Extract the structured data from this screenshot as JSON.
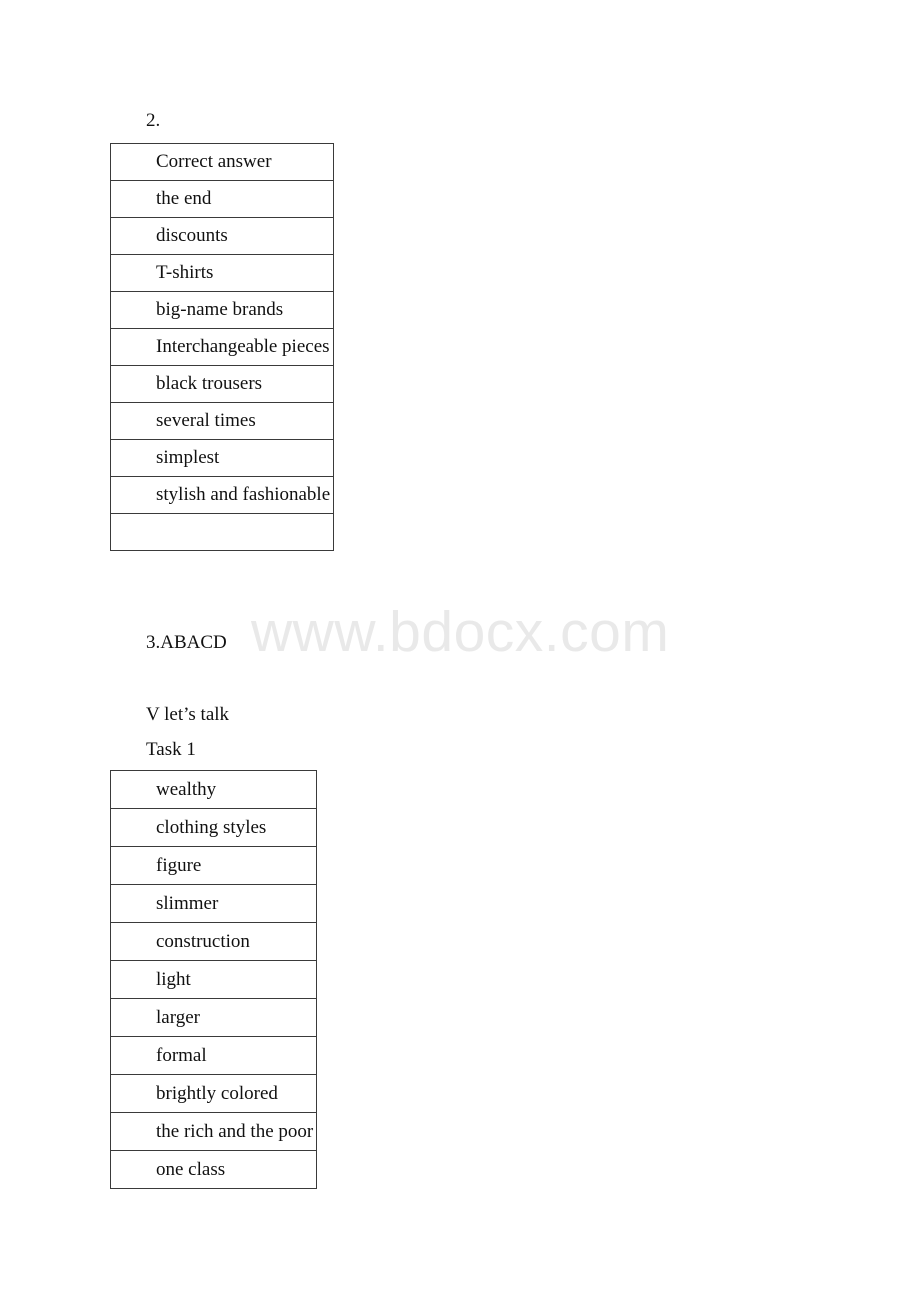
{
  "page": {
    "watermark_text": "www.bdocx.com",
    "watermark_color": "#e9e9e9",
    "background_color": "#ffffff",
    "text_color": "#111111",
    "table_border_color": "#3a3a3a"
  },
  "sections": {
    "item_2_label": "2.",
    "item_3_answers": "3.ABACD",
    "section_heading": "V let’s talk",
    "task_label": "Task 1"
  },
  "table_answers": {
    "header": "Correct answer",
    "rows": [
      "the end",
      "discounts",
      "T-shirts",
      "big-name brands",
      "Interchangeable pieces",
      "black trousers",
      "several times",
      "simplest",
      "stylish and fashionable",
      ""
    ]
  },
  "table_task1": {
    "rows": [
      "wealthy",
      "clothing styles",
      "figure",
      "slimmer",
      "construction",
      "light",
      "larger",
      "formal",
      "brightly colored",
      "the rich and the poor",
      "one class"
    ]
  }
}
